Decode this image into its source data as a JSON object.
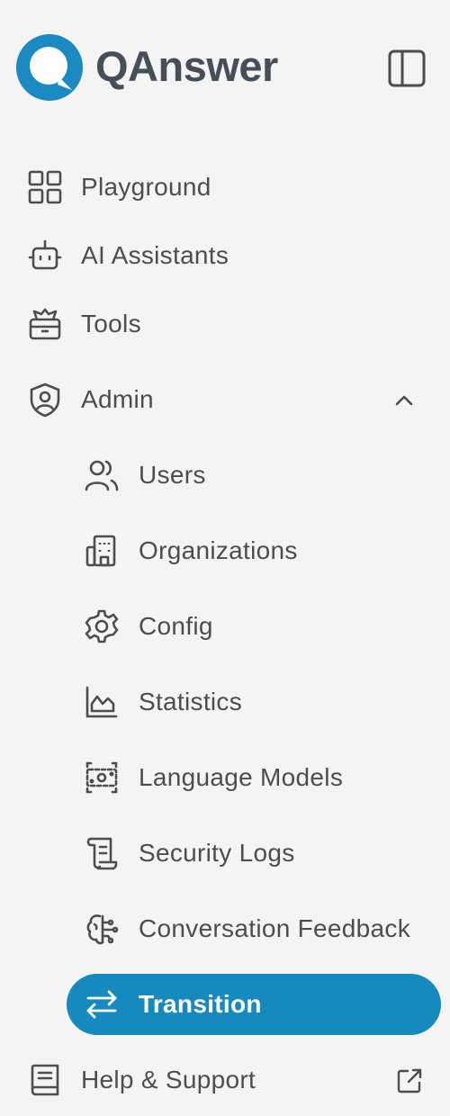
{
  "brand": {
    "name": "QAnswer"
  },
  "nav": {
    "playground": "Playground",
    "ai_assistants": "AI Assistants",
    "tools": "Tools",
    "admin": "Admin",
    "admin_items": {
      "users": "Users",
      "organizations": "Organizations",
      "config": "Config",
      "statistics": "Statistics",
      "language_models": "Language Models",
      "security_logs": "Security Logs",
      "conversation_feedback": "Conversation Feedback",
      "transition": "Transition"
    },
    "help": "Help & Support"
  },
  "colors": {
    "accent": "#1689be",
    "logo_blue": "#1b8ac0",
    "text": "#4d4d4d",
    "background": "#f4f4f4"
  },
  "icons": [
    "grid-icon",
    "robot-icon",
    "toolbox-icon",
    "shield-user-icon",
    "chevron-up-icon",
    "users-icon",
    "building-icon",
    "gear-icon",
    "chart-icon",
    "cpu-settings-icon",
    "scroll-icon",
    "brain-icon",
    "arrows-exchange-icon",
    "book-icon",
    "external-link-icon",
    "sidebar-toggle-icon",
    "qanswer-logo-icon"
  ]
}
